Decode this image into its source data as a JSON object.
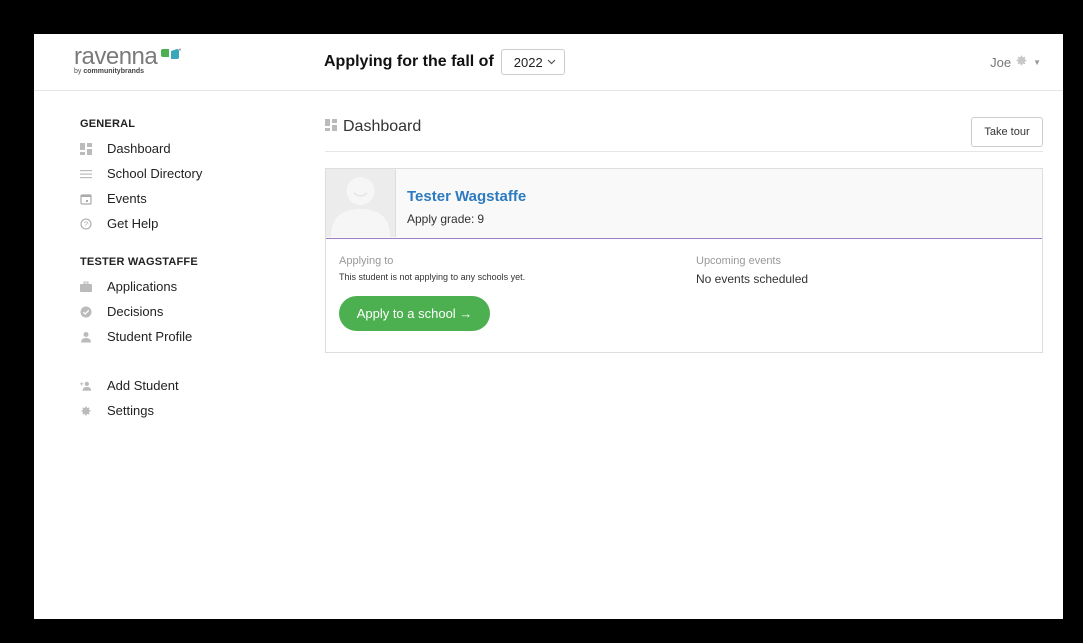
{
  "header": {
    "logo_word": "ravenna",
    "logo_by": "by",
    "logo_brand": "communitybrands",
    "apply_label": "Applying for the fall of",
    "year": "2022",
    "user_name": "Joe"
  },
  "sidebar": {
    "general_title": "GENERAL",
    "general_items": [
      {
        "label": "Dashboard",
        "icon": "dashboard-icon"
      },
      {
        "label": "School Directory",
        "icon": "list-icon"
      },
      {
        "label": "Events",
        "icon": "calendar-icon"
      },
      {
        "label": "Get Help",
        "icon": "help-icon"
      }
    ],
    "student_title": "TESTER WAGSTAFFE",
    "student_items": [
      {
        "label": "Applications",
        "icon": "briefcase-icon"
      },
      {
        "label": "Decisions",
        "icon": "check-circle-icon"
      },
      {
        "label": "Student Profile",
        "icon": "user-icon"
      }
    ],
    "extra_items": [
      {
        "label": "Add Student",
        "icon": "add-user-icon"
      },
      {
        "label": "Settings",
        "icon": "gear-icon"
      }
    ]
  },
  "main": {
    "title": "Dashboard",
    "tour_button": "Take tour",
    "student": {
      "name": "Tester Wagstaffe",
      "grade_label": "Apply grade:",
      "grade_value": "9"
    },
    "applying_to_label": "Applying to",
    "applying_to_text": "This student is not applying to any schools yet.",
    "upcoming_label": "Upcoming events",
    "upcoming_text": "No events scheduled",
    "apply_button": "Apply to a school →"
  },
  "colors": {
    "accent_green": "#4caf50",
    "link_blue": "#2d7bbf",
    "divider_purple": "#a27cc4",
    "logo_green": "#4caf50",
    "logo_teal": "#3aa6b9"
  }
}
